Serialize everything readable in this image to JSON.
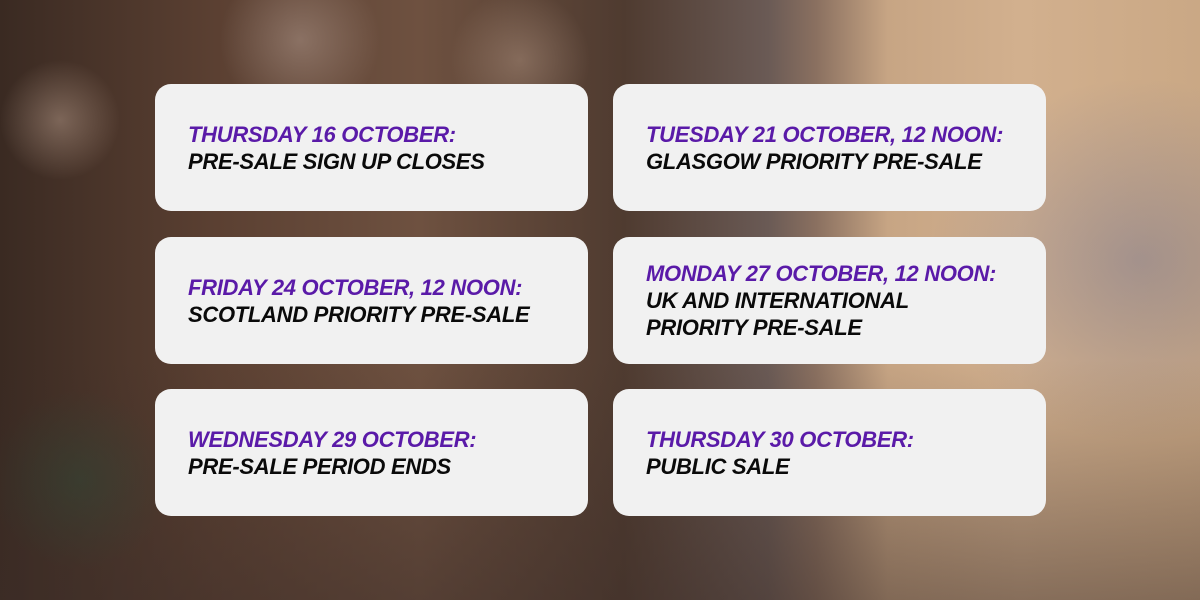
{
  "accent_color": "#5a1aa8",
  "cards": [
    {
      "date": "Thursday 16 October:",
      "event": "Pre-sale sign up closes"
    },
    {
      "date": "Tuesday 21 October, 12 noon:",
      "event": "Glasgow priority pre-sale"
    },
    {
      "date": "Friday 24 October, 12 noon:",
      "event": "Scotland priority pre-sale"
    },
    {
      "date": "Monday 27 October, 12 noon:",
      "event": "UK and International",
      "event2": "priority pre-sale"
    },
    {
      "date": "Wednesday 29 October:",
      "event": "Pre-sale period ends"
    },
    {
      "date": "Thursday 30 October:",
      "event": "Public sale"
    }
  ]
}
